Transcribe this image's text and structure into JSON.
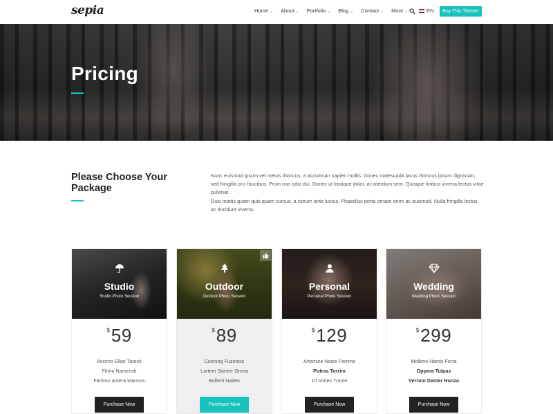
{
  "header": {
    "logo": "sepia",
    "nav": [
      {
        "label": "Home",
        "has_dropdown": true
      },
      {
        "label": "About",
        "has_dropdown": true
      },
      {
        "label": "Portfolio",
        "has_dropdown": true
      },
      {
        "label": "Blog",
        "has_dropdown": true
      },
      {
        "label": "Contact",
        "has_dropdown": true
      },
      {
        "label": "More",
        "has_dropdown": true
      }
    ],
    "language": "EN",
    "cta": "Buy This Theme!"
  },
  "hero": {
    "title": "Pricing"
  },
  "intro": {
    "title": "Please Choose Your Package",
    "paragraph1": "Nunc euismod ipsum vel metus rhoncus, a accumsan sapien mollis. Donec malesuada lacus rhoncus ipsum dignissim, sed fringilla orci faucibus. Proin non odio dui. Donec ut tristique dolor, at interdum sem. Quisque finibus viverra lectus vitae pulvinar.",
    "paragraph2": "Duis mattis quam quis quam cursus, a rutrum ante luctus. Phasellus porta ornare enim ac euismod. Nulla fringilla lectus ac tincidunt viverra."
  },
  "plans": [
    {
      "name": "Studio",
      "subtitle": "Studio Photo Session",
      "icon": "umbrella-icon",
      "currency": "$",
      "price": "59",
      "features": [
        "Ascimo Ellan Tareck",
        "Fitrim Namzeck",
        "Fartimo antera Maunos"
      ],
      "bold_features": [],
      "button": "Purchase Now",
      "featured": false
    },
    {
      "name": "Outdoor",
      "subtitle": "Outdoor Photo Session",
      "icon": "tree-icon",
      "currency": "$",
      "price": "89",
      "features": [
        "Cunning Fuziness",
        "Lartem Sainter Omna",
        "Bullerti Naiten"
      ],
      "bold_features": [],
      "button": "Purchase Now",
      "featured": true
    },
    {
      "name": "Personal",
      "subtitle": "Personal Photo Session",
      "icon": "user-icon",
      "currency": "$",
      "price": "129",
      "features": [
        "Artemize Naice Femme",
        "Putras Torrim",
        "10 Voites Trante"
      ],
      "bold_features": [
        1
      ],
      "button": "Purchase Now",
      "featured": false
    },
    {
      "name": "Wedding",
      "subtitle": "Wedding Photo Session",
      "icon": "diamond-icon",
      "currency": "$",
      "price": "299",
      "features": [
        "Mollimo Namis Ferra",
        "Oppera Tulpas",
        "Verrum Daster Hunza"
      ],
      "bold_features": [
        1,
        2
      ],
      "button": "Purchase Now",
      "featured": false
    }
  ],
  "colors": {
    "accent": "#17c2bc",
    "dark_button": "#222222",
    "featured_bg": "#efeff1"
  }
}
